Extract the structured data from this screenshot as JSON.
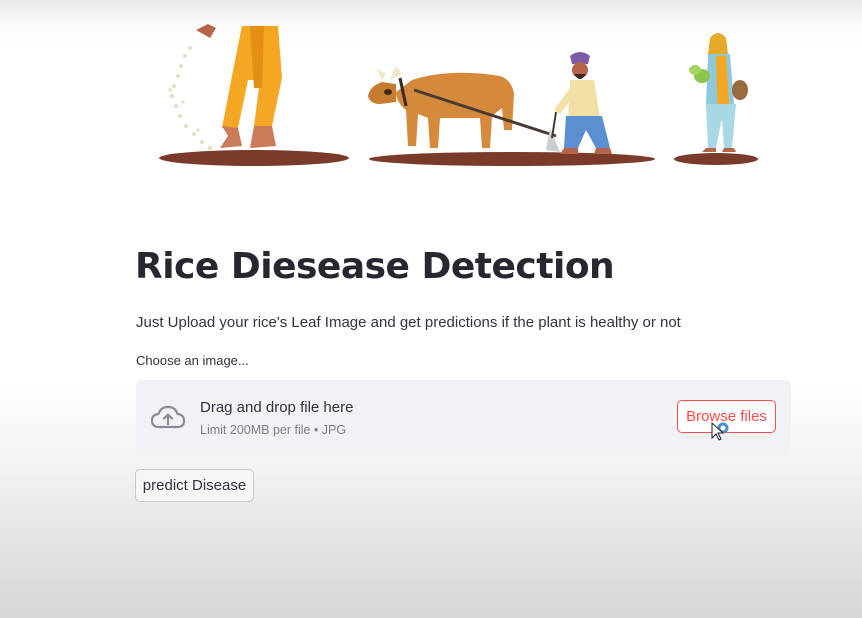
{
  "header": {
    "title": "Rice Diesease Detection",
    "subtitle": "Just Upload your rice's Leaf Image and get predictions if the plant is healthy or not"
  },
  "uploader": {
    "label": "Choose an image...",
    "drop_text": "Drag and drop file here",
    "limit_text": "Limit 200MB per file • JPG",
    "browse_label": "Browse files",
    "icon": "cloud-upload-icon"
  },
  "actions": {
    "predict_label": "predict Disease"
  },
  "colors": {
    "accent": "#ff4b4b",
    "text": "#31333f",
    "dropzone_bg": "#f0f2f6",
    "muted_text": "#7d7f87"
  }
}
